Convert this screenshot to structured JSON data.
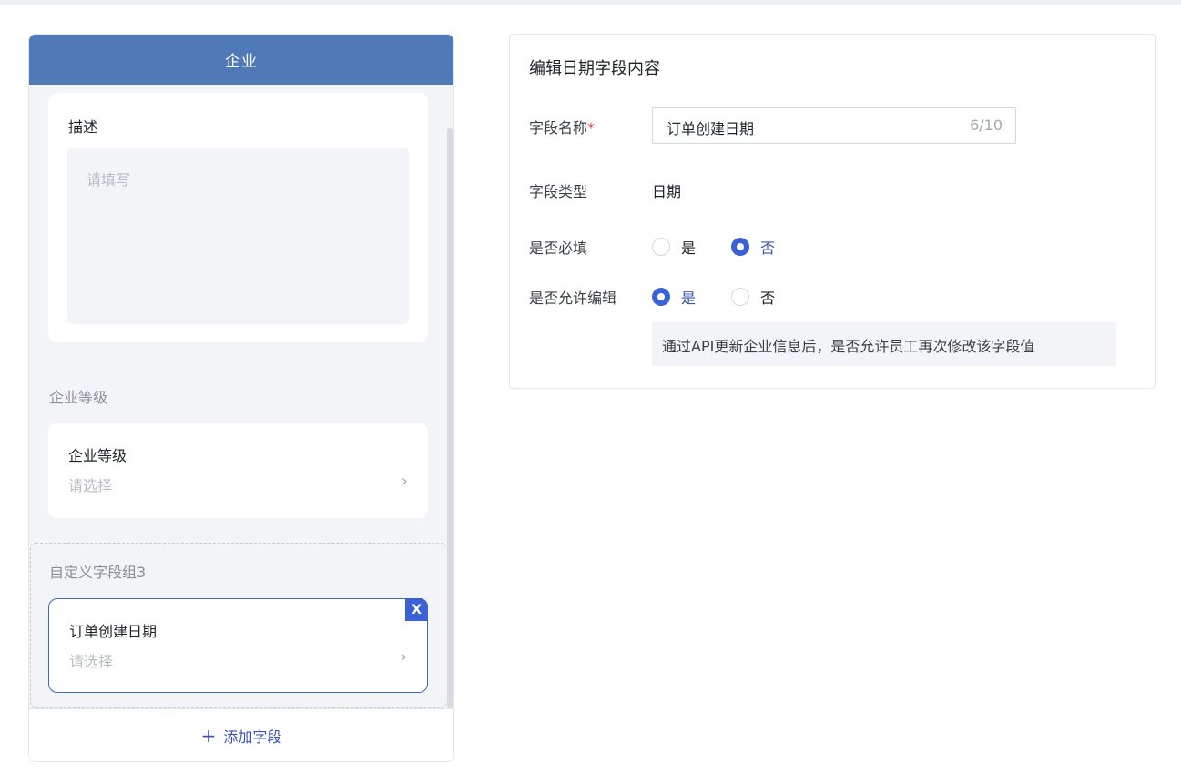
{
  "left": {
    "header_title": "企业",
    "description_card": {
      "title": "描述",
      "placeholder": "请填写"
    },
    "level_group": {
      "label": "企业等级",
      "card_title": "企业等级",
      "placeholder": "请选择"
    },
    "custom_group": {
      "label": "自定义字段组3",
      "card_title": "订单创建日期",
      "placeholder": "请选择",
      "delete_label": "X"
    },
    "add_field_label": "添加字段",
    "add_icon": "+",
    "chevron_icon": "›"
  },
  "right": {
    "title": "编辑日期字段内容",
    "field_name": {
      "label": "字段名称",
      "required_mark": "*",
      "value": "订单创建日期",
      "count": "6/10"
    },
    "field_type": {
      "label": "字段类型",
      "value": "日期"
    },
    "required": {
      "label": "是否必填",
      "options": [
        "是",
        "否"
      ],
      "selected": "否"
    },
    "editable": {
      "label": "是否允许编辑",
      "options": [
        "是",
        "否"
      ],
      "selected": "是"
    },
    "hint": "通过API更新企业信息后，是否允许员工再次修改该字段值"
  },
  "colors": {
    "header_bg": "#4f79b7",
    "accent": "#3a62d6",
    "link": "#3a55b0"
  }
}
